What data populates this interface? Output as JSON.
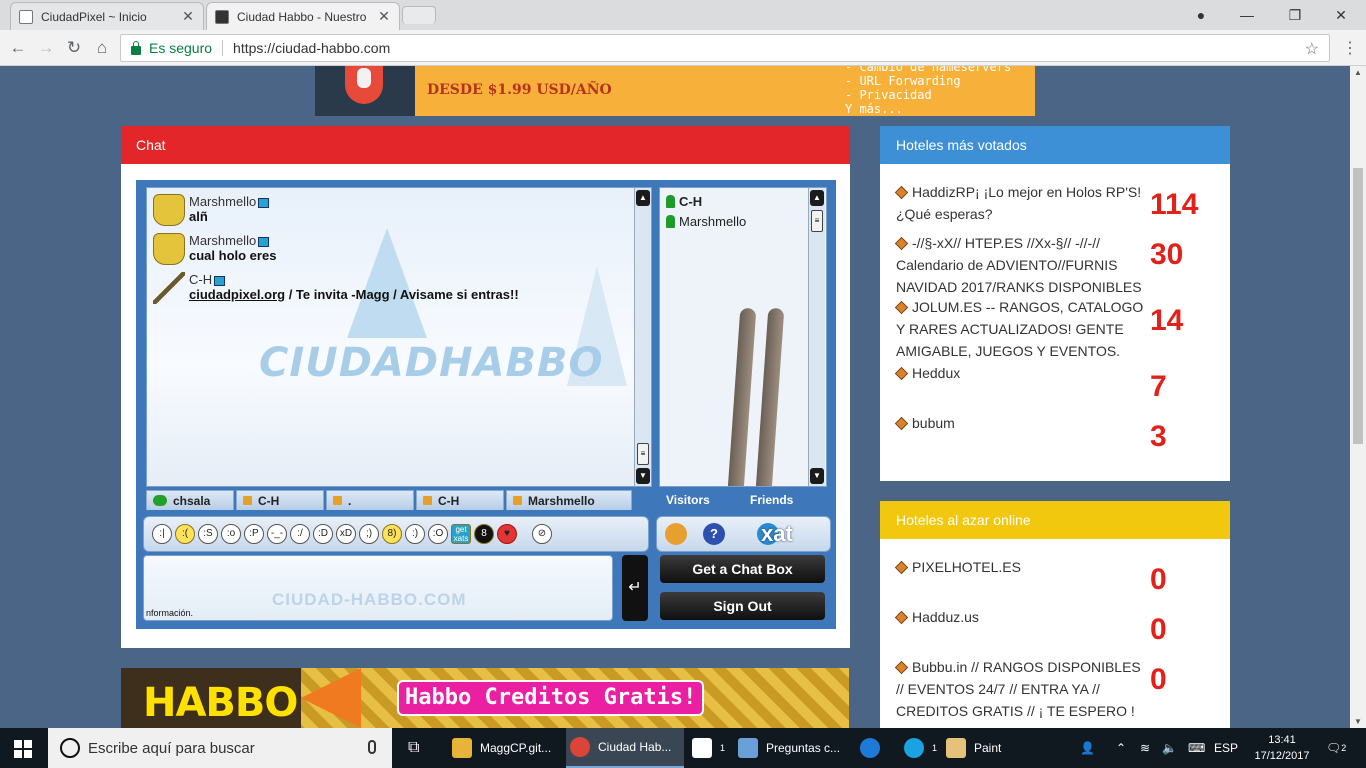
{
  "browser": {
    "tabs": [
      {
        "title": "CiudadPixel ~ Inicio",
        "close": "✕"
      },
      {
        "title": "Ciudad Habbo - Nuestro",
        "close": "✕"
      }
    ],
    "secure_label": "Es seguro",
    "url": "https://ciudad-habbo.com"
  },
  "top_ad": {
    "price_text": "DESDE $1.99 USD/AÑO",
    "features": "- Cambio de nameservers\n- URL Forwarding\n- Privacidad\nY más..."
  },
  "chat": {
    "header": "Chat",
    "watermark": "CIUDADHABBO",
    "messages": [
      {
        "user": "Marshmello",
        "text": "alñ"
      },
      {
        "user": "Marshmello",
        "text": "cual holo eres"
      },
      {
        "user": "C-H",
        "link": "ciudadpixel.org",
        "text": " / Te invita -Magg / Avisame si entras!!"
      }
    ],
    "users": [
      "C-H",
      "Marshmello"
    ],
    "tabs": [
      "chsala",
      "C-H",
      ".",
      "C-H",
      "Marshmello"
    ],
    "right_tabs": [
      "Visitors",
      "Friends"
    ],
    "get_chat_box": "Get a Chat Box",
    "sign_out": "Sign Out",
    "input_watermark": "CIUDAD-HABBO.COM",
    "info_text": "nformación.",
    "xat_logo": "xat",
    "help_icon_label": "?",
    "getxats_label": "get\nxats",
    "send_symbol": "↵"
  },
  "bottom_ad": {
    "logo": "HABBO",
    "slogan": "Habbo Creditos Gratis!"
  },
  "hotels_voted": {
    "header": "Hoteles más votados",
    "items": [
      {
        "name": "HaddizRP¡ ¡Lo mejor en Holos RP'S! ¿Qué esperas?",
        "votes": "114"
      },
      {
        "name": "-//§-xX// HTEP.ES //Xx-§// -//-// Calendario de ADVIENTO//FURNIS NAVIDAD 2017/RANKS DISPONIBLES",
        "votes": "30"
      },
      {
        "name": "JOLUM.ES -- RANGOS, CATALOGO Y RARES ACTUALIZADOS! GENTE AMIGABLE, JUEGOS Y EVENTOS.",
        "votes": "14"
      },
      {
        "name": "Heddux",
        "votes": "7"
      },
      {
        "name": "bubum",
        "votes": "3"
      }
    ]
  },
  "hotels_random": {
    "header": "Hoteles al azar online",
    "items": [
      {
        "name": "PIXELHOTEL.ES",
        "votes": "0"
      },
      {
        "name": "Hadduz.us",
        "votes": "0"
      },
      {
        "name": "Bubbu.in // RANGOS DISPONIBLES // EVENTOS 24/7 // ENTRA YA // CREDITOS GRATIS // ¡ TE ESPERO !",
        "votes": "0"
      }
    ]
  },
  "taskbar": {
    "search_placeholder": "Escribe aquí para buscar",
    "items": [
      "MaggCP.git...",
      "Ciudad Hab...",
      "Preguntas c...",
      "Paint"
    ],
    "badges": [
      "1",
      "1"
    ],
    "lang": "ESP",
    "time": "13:41",
    "date": "17/12/2017",
    "notif_count": "2"
  },
  "colors": {
    "chat_header": "#e2262a",
    "voted_header": "#3d8fd6",
    "random_header": "#f2c80f",
    "votes": "#e0221a",
    "page_bg": "#4a6585"
  }
}
